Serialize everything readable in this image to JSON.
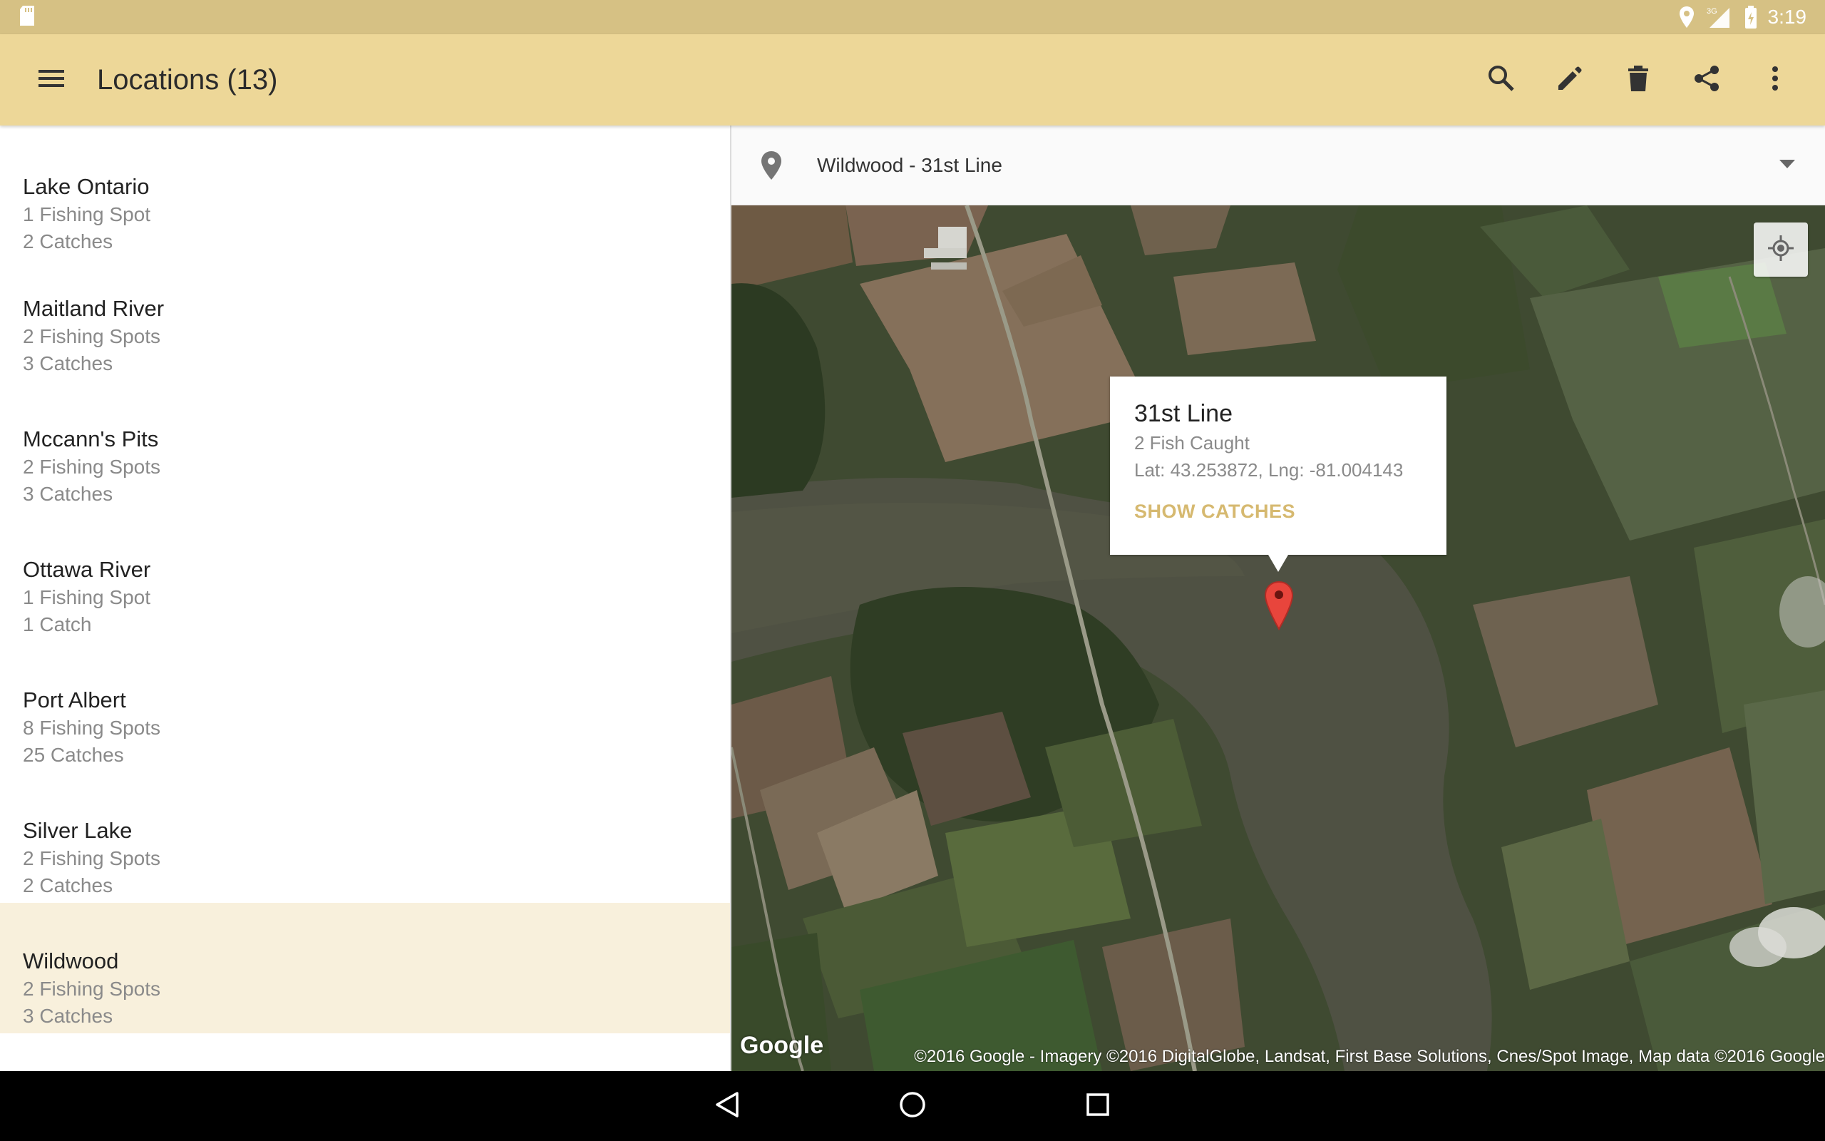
{
  "status_bar": {
    "time": "3:19",
    "network": "3G",
    "icons": [
      "sd-card-icon",
      "location-icon",
      "signal-icon",
      "battery-icon"
    ]
  },
  "app_bar": {
    "title": "Locations (13)",
    "actions": [
      "search-icon",
      "edit-icon",
      "delete-icon",
      "share-icon",
      "overflow-icon"
    ]
  },
  "locations": [
    {
      "name": "Lake Ontario",
      "spots": "1 Fishing Spot",
      "catches": "2 Catches",
      "selected": false
    },
    {
      "name": "Maitland River",
      "spots": "2 Fishing Spots",
      "catches": "3 Catches",
      "selected": false
    },
    {
      "name": "Mccann's Pits",
      "spots": "2 Fishing Spots",
      "catches": "3 Catches",
      "selected": false
    },
    {
      "name": "Ottawa River",
      "spots": "1 Fishing Spot",
      "catches": "1 Catch",
      "selected": false
    },
    {
      "name": "Port Albert",
      "spots": "8 Fishing Spots",
      "catches": "25 Catches",
      "selected": false
    },
    {
      "name": "Silver Lake",
      "spots": "2 Fishing Spots",
      "catches": "2 Catches",
      "selected": false
    },
    {
      "name": "Wildwood",
      "spots": "2 Fishing Spots",
      "catches": "3 Catches",
      "selected": true
    }
  ],
  "spot_selector": {
    "value": "Wildwood - 31st Line"
  },
  "info_window": {
    "title": "31st Line",
    "fish_caught": "2 Fish Caught",
    "coords": "Lat: 43.253872, Lng: -81.004143",
    "action": "SHOW CATCHES"
  },
  "map": {
    "logo": "Google",
    "attribution": "©2016 Google - Imagery ©2016 DigitalGlobe, Landsat, First Base Solutions, Cnes/Spot Image, Map data ©2016 Google"
  },
  "colors": {
    "status_bar": "#d6c184",
    "app_bar": "#edd798",
    "selected_row": "#f8f0dc",
    "accent": "#d6b970",
    "marker": "#e8453c"
  }
}
